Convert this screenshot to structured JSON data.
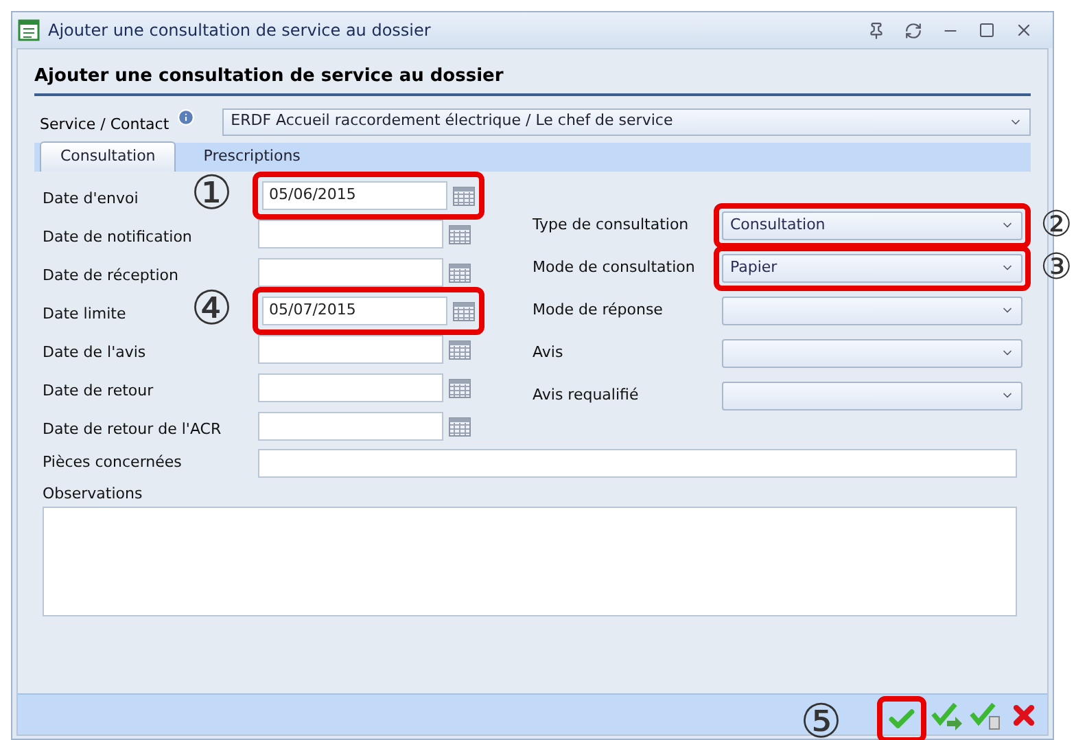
{
  "window": {
    "title": "Ajouter une consultation de service au dossier"
  },
  "heading": "Ajouter une consultation de service au dossier",
  "service": {
    "label": "Service / Contact",
    "value": "ERDF Accueil raccordement électrique / Le chef de service"
  },
  "tabs": [
    {
      "label": "Consultation",
      "selected": true
    },
    {
      "label": "Prescriptions",
      "selected": false
    }
  ],
  "date_fields": [
    {
      "label": "Date d'envoi",
      "value": "05/06/2015",
      "highlighted": true,
      "callout": "①"
    },
    {
      "label": "Date de notification",
      "highlighted": false
    },
    {
      "label": "Date de réception",
      "highlighted": false
    },
    {
      "label": "Date limite",
      "value": "05/07/2015",
      "highlighted": true,
      "callout": "④"
    },
    {
      "label": "Date de l'avis",
      "highlighted": false
    },
    {
      "label": "Date de retour",
      "highlighted": false
    },
    {
      "label": "Date de retour de l'ACR",
      "highlighted": false
    }
  ],
  "select_fields": [
    {
      "label": "Type de consultation",
      "value": "Consultation",
      "highlighted": true,
      "callout": "②"
    },
    {
      "label": "Mode de consultation",
      "value": "Papier",
      "highlighted": true,
      "callout": "③"
    },
    {
      "label": "Mode de réponse",
      "highlighted": false
    },
    {
      "label": "Avis",
      "highlighted": false
    },
    {
      "label": "Avis requalifié",
      "highlighted": false
    }
  ],
  "pieces": {
    "label": "Pièces concernées"
  },
  "observations": {
    "label": "Observations"
  },
  "footer_buttons": [
    {
      "kind": "validate",
      "highlighted": true,
      "callout": "⑤"
    },
    {
      "kind": "validate-next",
      "highlighted": false
    },
    {
      "kind": "validate-document",
      "highlighted": false
    },
    {
      "kind": "cancel",
      "highlighted": false
    }
  ]
}
